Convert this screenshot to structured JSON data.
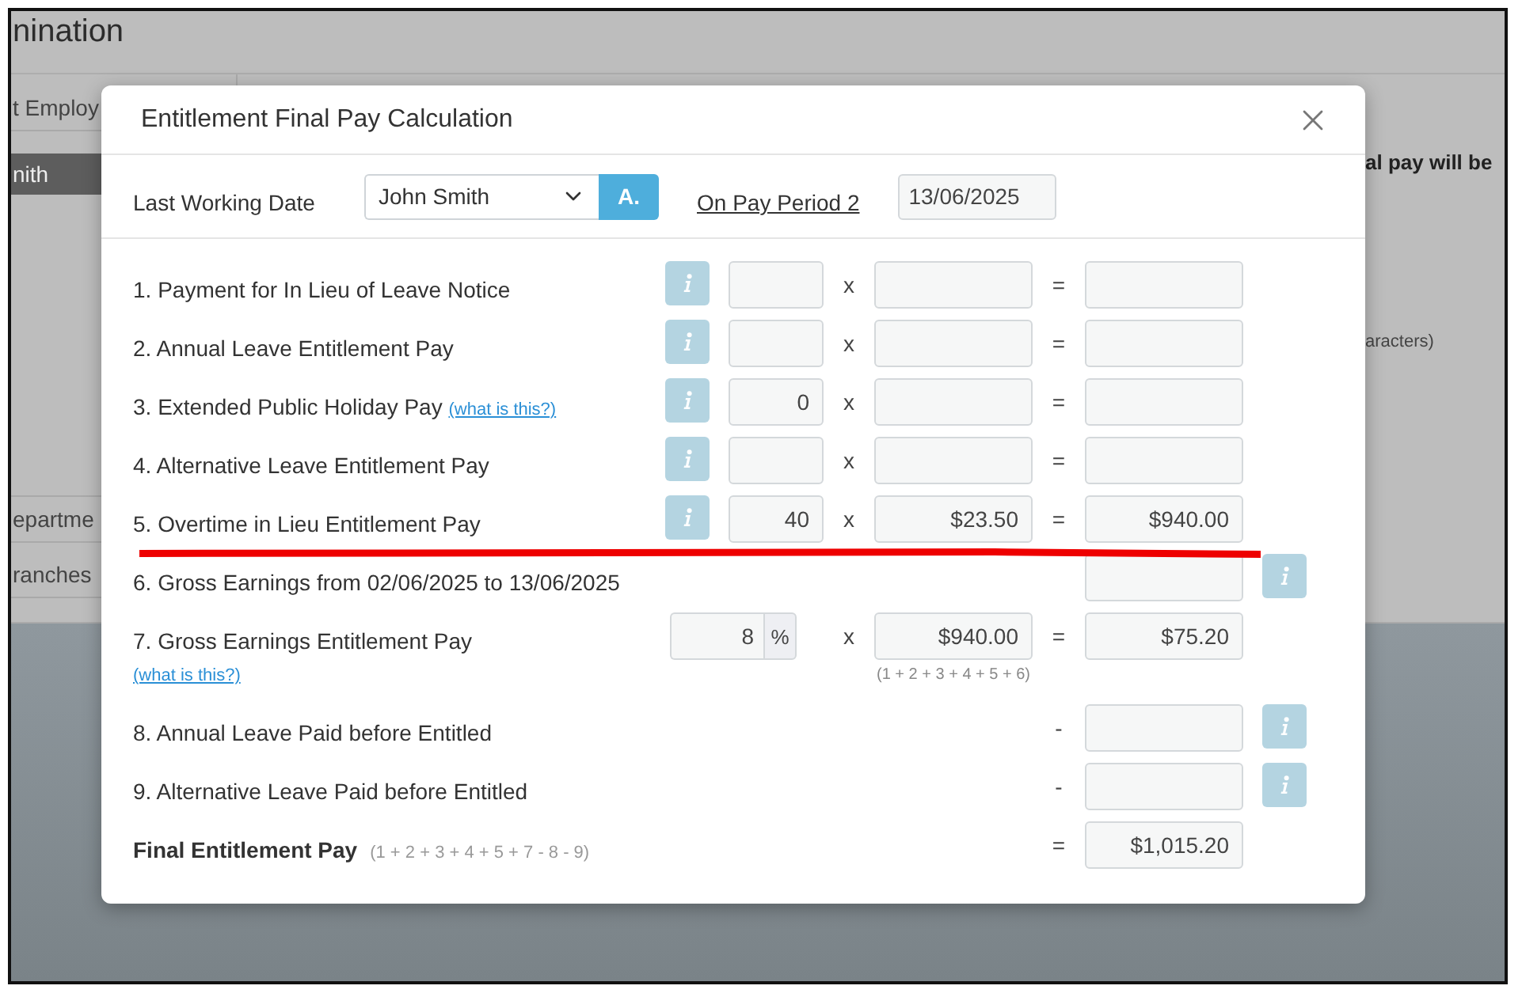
{
  "background": {
    "title": "nination",
    "sidebar": [
      {
        "label": "t Employ",
        "selected": false
      },
      {
        "label": "nith",
        "selected": true
      },
      {
        "label": "epartme",
        "selected": false
      },
      {
        "label": "ranches",
        "selected": false
      }
    ],
    "notes": [
      {
        "text": "al pay will be",
        "kind": "heading"
      },
      {
        "text": "aracters)",
        "kind": "hint"
      }
    ]
  },
  "dialog": {
    "title": "Entitlement Final Pay Calculation",
    "toolbar": {
      "label": "Last Working Date",
      "employee": "John Smith",
      "button": "A.",
      "period_link": "On Pay Period 2",
      "date": "13/06/2025"
    },
    "rows": [
      {
        "kind": "multiply",
        "label": "1. Payment for In Lieu of Leave Notice",
        "op1": "x",
        "op2": "="
      },
      {
        "kind": "multiply",
        "label": "2. Annual Leave Entitlement Pay",
        "op1": "x",
        "op2": "="
      },
      {
        "kind": "multiply",
        "label": "3. Extended Public Holiday Pay",
        "link": "(what is this?)",
        "quantity": "0",
        "op1": "x",
        "op2": "="
      },
      {
        "kind": "multiply",
        "label": "4. Alternative Leave Entitlement Pay",
        "op1": "x",
        "op2": "="
      },
      {
        "kind": "multiply",
        "label": "5. Overtime in Lieu Entitlement Pay",
        "quantity": "40",
        "op1": "x",
        "rate": "$23.50",
        "op2": "=",
        "amount": "$940.00"
      },
      {
        "kind": "sum",
        "label": "6. Gross Earnings from 02/06/2025 to 13/06/2025"
      },
      {
        "kind": "percent",
        "label": "7. Gross Earnings Entitlement Pay",
        "link": "(what is this?)",
        "quantity": "8",
        "unit": "%",
        "op1": "x",
        "rate": "$940.00",
        "rate_note": "(1 + 2 + 3 + 4 + 5 + 6)",
        "op2": "=",
        "amount": "$75.20"
      },
      {
        "kind": "deduct",
        "label": "8. Annual Leave Paid before Entitled",
        "op2": "-"
      },
      {
        "kind": "deduct",
        "label": "9. Alternative Leave Paid before Entitled",
        "op2": "-"
      }
    ],
    "total": {
      "label": "Final Entitlement Pay",
      "formula": "(1 + 2 + 3 + 4 + 5 + 7 - 8 - 9)",
      "operator": "=",
      "amount": "$1,015.20"
    }
  }
}
